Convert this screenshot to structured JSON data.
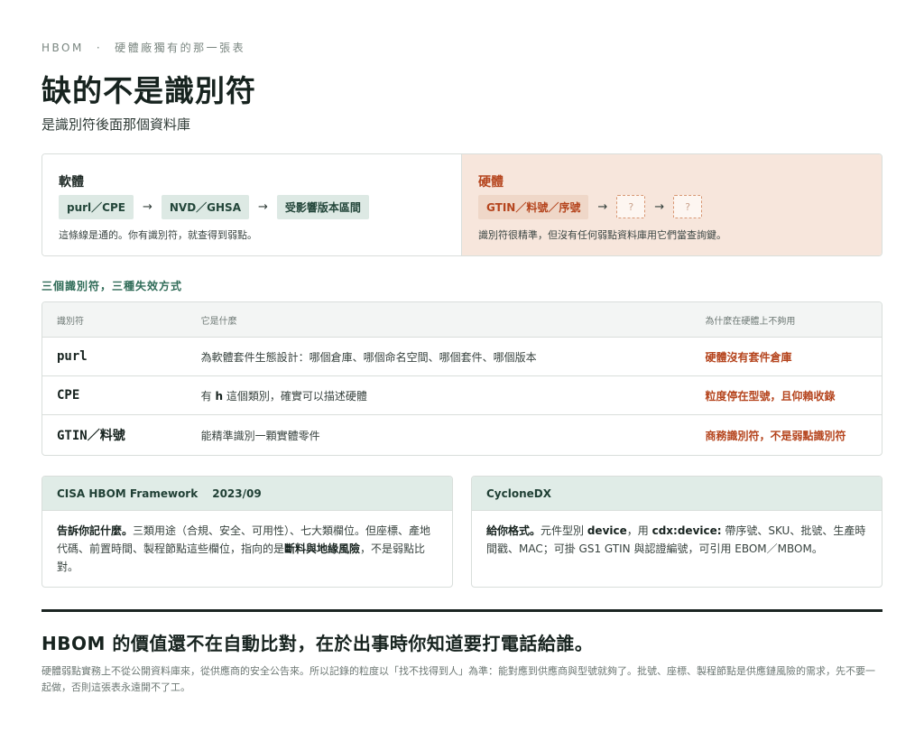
{
  "header": {
    "eyebrow_left": "HBOM",
    "eyebrow_sep": "·",
    "eyebrow_right": "硬體廠獨有的那一張表",
    "title": "缺的不是識別符",
    "subtitle": "是識別符後面那個資料庫"
  },
  "compare": {
    "software": {
      "title": "軟體",
      "chain": [
        "purl／CPE",
        "NVD／GHSA",
        "受影響版本區間"
      ],
      "arrow": "→",
      "note": "這條線是通的。你有識別符，就查得到弱點。"
    },
    "hardware": {
      "title": "硬體",
      "chain": [
        "GTIN／料號／序號"
      ],
      "unknown": "?",
      "arrow": "→",
      "note": "識別符很精準，但沒有任何弱點資料庫用它們當查詢鍵。"
    }
  },
  "section_label": "三個識別符，三種失效方式",
  "table": {
    "headers": [
      "識別符",
      "它是什麼",
      "為什麼在硬體上不夠用"
    ],
    "rows": [
      {
        "id": "purl",
        "what": "為軟體套件生態設計：哪個倉庫、哪個命名空間、哪個套件、哪個版本",
        "why": "硬體沒有套件倉庫"
      },
      {
        "id": "CPE",
        "what_pre": "有 ",
        "what_bold": "h",
        "what_post": " 這個類別，確實可以描述硬體",
        "why": "粒度停在型號，且仰賴收錄"
      },
      {
        "id": "GTIN／料號",
        "what": "能精準識別一顆實體零件",
        "why": "商務識別符，不是弱點識別符"
      }
    ]
  },
  "cards": {
    "cisa": {
      "name": "CISA HBOM Framework",
      "year": "2023/09",
      "lead": "告訴你記什麼。",
      "text1": "三類用途（合規、安全、可用性）、七大類欄位。但座標、產地代碼、前置時間、製程節點這些欄位，指向的是",
      "bold": "斷料與地緣風險",
      "text2": "，不是弱點比對。"
    },
    "cyclonedx": {
      "name": "CycloneDX",
      "lead": "給你格式。",
      "text1": "元件型別 ",
      "bold1": "device",
      "text2": "，用 ",
      "bold2": "cdx:device:",
      "text3": " 帶序號、SKU、批號、生產時間戳、MAC；可掛 GS1 GTIN 與認證編號，可引用 EBOM／MBOM。"
    }
  },
  "closing": {
    "headline": "HBOM 的價值還不在自動比對，在於出事時你知道要打電話給誰。",
    "note": "硬體弱點實務上不從公開資料庫來，從供應商的安全公告來。所以記錄的粒度以「找不找得到人」為準：能對應到供應商與型號就夠了。批號、座標、製程節點是供應鏈風險的需求，先不要一起做，否則這張表永遠開不了工。"
  }
}
